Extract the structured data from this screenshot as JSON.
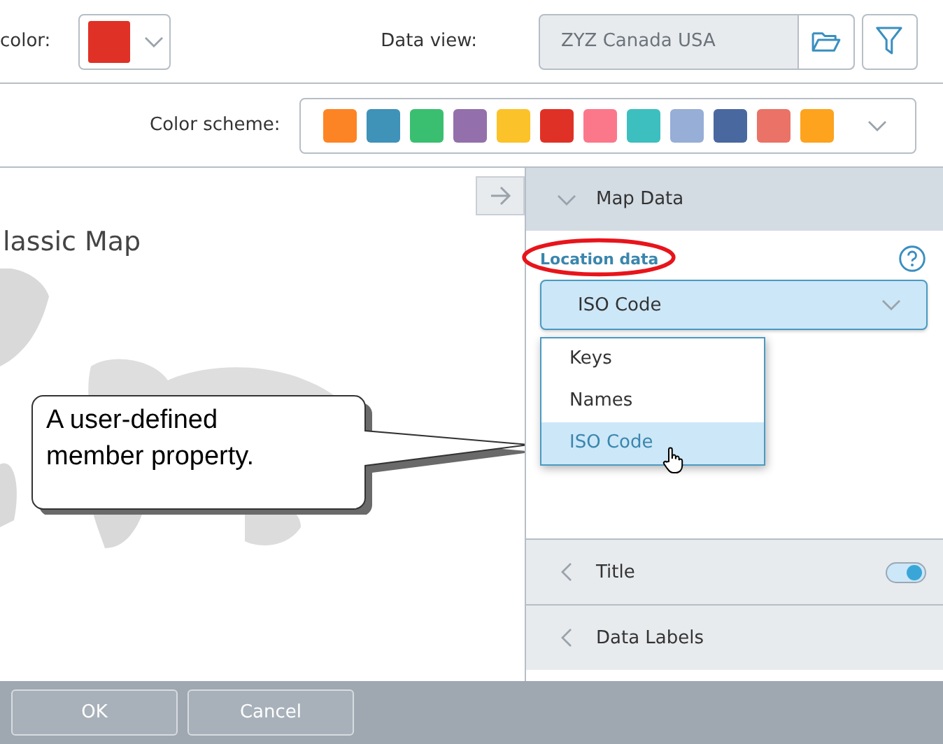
{
  "toolbar": {
    "color_label": "color:",
    "swatch": {
      "color": "#e03127"
    },
    "data_view_label": "Data view:",
    "data_view_value": "ZYZ Canada USA"
  },
  "color_scheme": {
    "label": "Color scheme:",
    "chips": [
      {
        "color": "#fd8424"
      },
      {
        "color": "#3f92b8"
      },
      {
        "color": "#3abf71"
      },
      {
        "color": "#9370ab"
      },
      {
        "color": "#fbc22a"
      },
      {
        "color": "#e03127"
      },
      {
        "color": "#fb788b"
      },
      {
        "color": "#3dbfbf"
      },
      {
        "color": "#97aed6"
      },
      {
        "color": "#4a68a0"
      },
      {
        "color": "#ea7266"
      },
      {
        "color": "#fda31e"
      }
    ]
  },
  "map": {
    "title": "lassic Map"
  },
  "callout": {
    "text": "A user-defined member property."
  },
  "panel": {
    "map_data": {
      "title": "Map Data",
      "expanded": true,
      "location_label": "Location data",
      "location_value": "ISO Code",
      "options": [
        {
          "label": "Keys",
          "selected": false
        },
        {
          "label": "Names",
          "selected": false
        },
        {
          "label": "ISO Code",
          "selected": true
        }
      ]
    },
    "sections": [
      {
        "title": "Title",
        "expanded": false,
        "kind": "toggle",
        "on": true
      },
      {
        "title": "Data Labels",
        "expanded": false,
        "kind": "plain"
      }
    ]
  },
  "buttons": [
    "OK",
    "Cancel"
  ]
}
